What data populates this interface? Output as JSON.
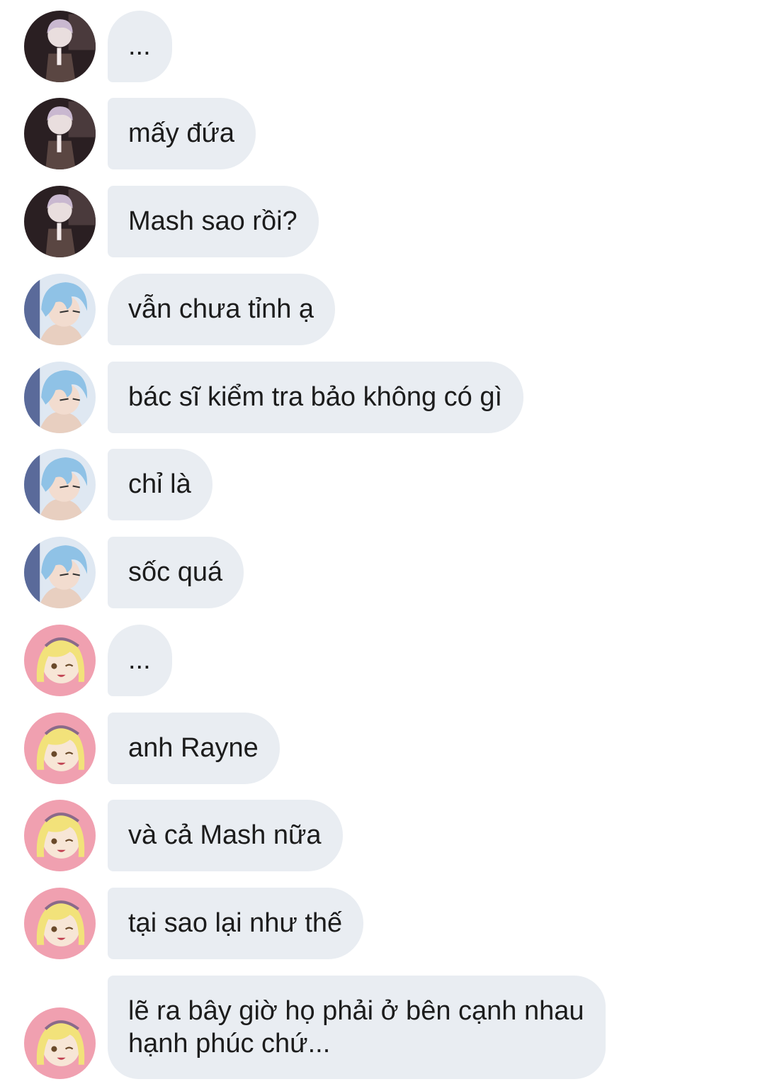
{
  "avatars": {
    "rayne": {
      "name": "rayne-avatar-icon",
      "hair": "#c9b8d0",
      "bg": "#2a1f22"
    },
    "blue": {
      "name": "blue-hair-avatar-icon",
      "hair": "#8fc2e6",
      "bg": "#dfe8f2"
    },
    "blonde": {
      "name": "blonde-avatar-icon",
      "hair": "#f2e27a",
      "bg": "#f0a0b0"
    }
  },
  "colors": {
    "bubble_bg": "#e9edf2",
    "text": "#1c1c1c",
    "page_bg": "#ffffff"
  },
  "messages": [
    {
      "sender": "rayne",
      "text": "..."
    },
    {
      "sender": "rayne",
      "text": "mấy đứa"
    },
    {
      "sender": "rayne",
      "text": "Mash sao rồi?"
    },
    {
      "sender": "blue",
      "text": "vẫn chưa tỉnh ạ"
    },
    {
      "sender": "blue",
      "text": "bác sĩ kiểm tra bảo không có gì"
    },
    {
      "sender": "blue",
      "text": "chỉ là"
    },
    {
      "sender": "blue",
      "text": "sốc quá"
    },
    {
      "sender": "blonde",
      "text": "..."
    },
    {
      "sender": "blonde",
      "text": "anh Rayne"
    },
    {
      "sender": "blonde",
      "text": "và cả Mash nữa"
    },
    {
      "sender": "blonde",
      "text": "tại sao lại như thế"
    },
    {
      "sender": "blonde",
      "text": "lẽ ra bây giờ họ phải ở bên cạnh nhau\nhạnh phúc chứ..."
    }
  ]
}
